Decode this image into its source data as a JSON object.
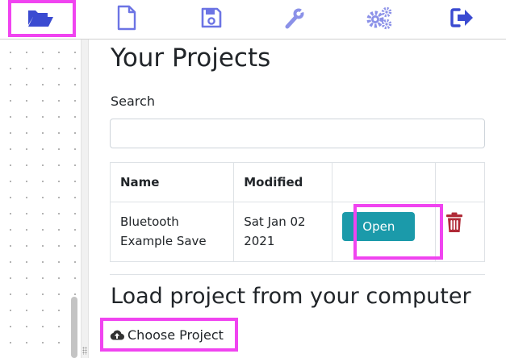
{
  "toolbar": {
    "icons": [
      "open-folder-icon",
      "new-file-icon",
      "save-icon",
      "wrench-icon",
      "gears-icon",
      "sign-out-icon"
    ],
    "colors": {
      "active": "#3b4bd1",
      "inactive": "#8b91e8",
      "highlight": "#f044f0"
    }
  },
  "projects": {
    "title": "Your Projects",
    "search_label": "Search",
    "search_value": "",
    "columns": [
      "Name",
      "Modified",
      "",
      ""
    ],
    "rows": [
      {
        "name": "Bluetooth Example Save",
        "modified": "Sat Jan 02 2021",
        "open_label": "Open"
      }
    ]
  },
  "load": {
    "title": "Load project from your computer",
    "choose_label": "Choose Project"
  },
  "colors": {
    "accent": "#1b9aaa",
    "danger": "#b02a37"
  }
}
